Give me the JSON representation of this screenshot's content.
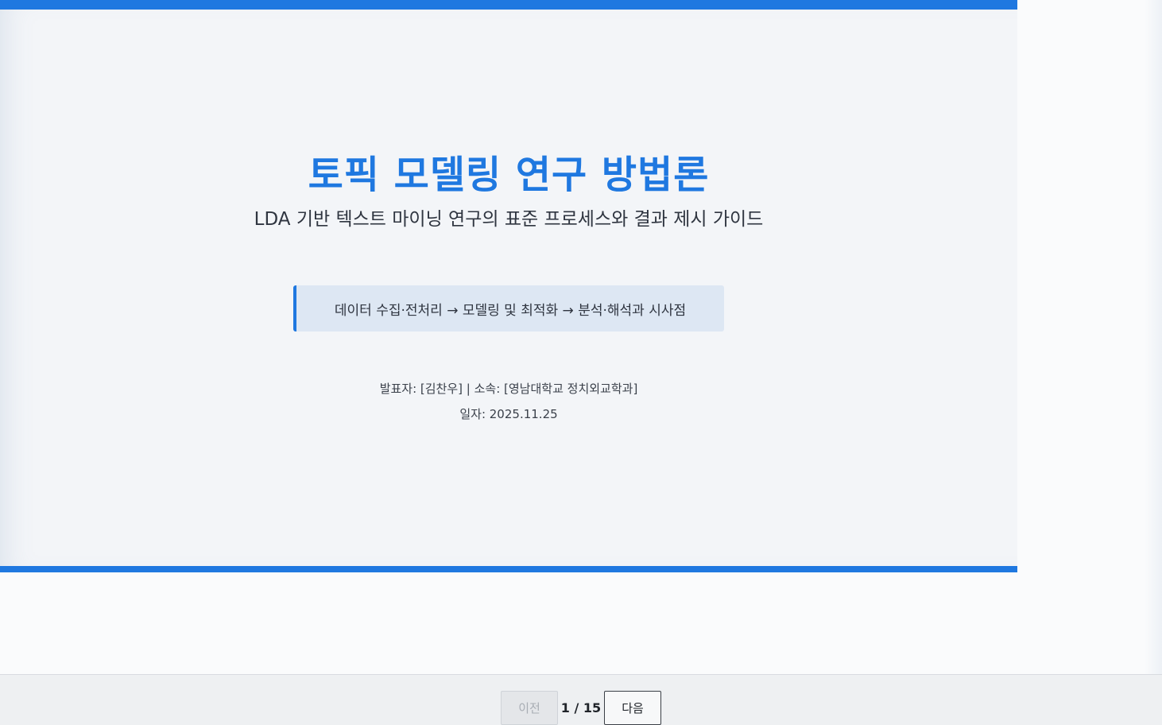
{
  "slide": {
    "title": "토픽 모델링 연구 방법론",
    "subtitle": "LDA 기반 텍스트 마이닝 연구의 표준 프로세스와 결과 제시 가이드",
    "flow": "데이터 수집·전처리 → 모델링 및 최적화 → 분석·해석과 시사점",
    "presenter_line": "발표자: [김찬우] | 소속: [영남대학교 정치외교학과]",
    "date_line": "일자: 2025.11.25"
  },
  "controls": {
    "prev_label": "이전",
    "next_label": "다음",
    "counter": "1 / 15"
  },
  "colors": {
    "accent": "#1f78e0",
    "slide_bg": "#f3f5f8",
    "flow_box_bg": "#dde7f3"
  }
}
